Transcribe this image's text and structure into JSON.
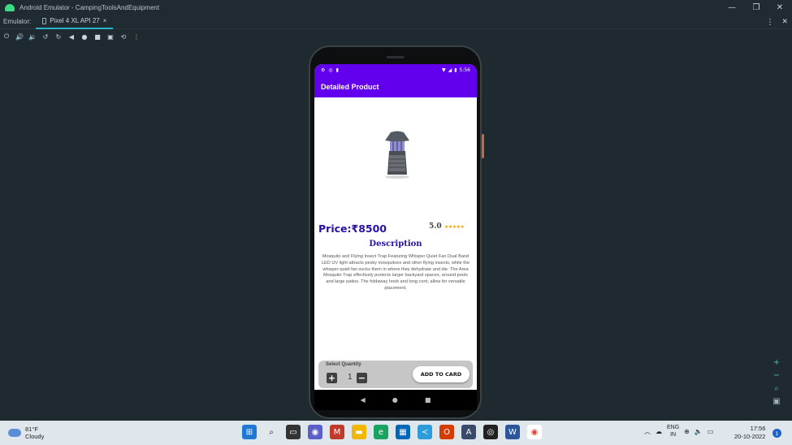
{
  "window": {
    "title": "Android Emulator - CampingToolsAndEquipment",
    "minimize": "—",
    "restore": "❐",
    "close": "✕"
  },
  "tabbar": {
    "label": "Emulator:",
    "tab_label": "Pixel 4 XL API 27",
    "tab_close": "×",
    "kebab": "⋮",
    "right_close": "✕"
  },
  "toolbar": {
    "icons": [
      "power-icon",
      "volume-up-icon",
      "volume-down-icon",
      "rotate-left-icon",
      "rotate-right-icon",
      "back-icon",
      "home-icon",
      "overview-icon",
      "camera-icon",
      "snapshot-icon",
      "more-icon"
    ]
  },
  "device": {
    "status_time": "5:56",
    "app_title": "Detailed Product",
    "price": "Price:₹8500",
    "rating": "5.0",
    "stars": "★★★★★",
    "description_title": "Description",
    "description": "Mosquito and Flying Insect Trap Featuring Whisper Quiet Fan Dual Band LED UV light attracts pesky mosquitoes and other flying insects, while the whisper-quiet fan sucks them in where they dehydrate and die. The Area Mosquito Trap effectively protects larger backyard spaces, around pools and large patios. The foldaway hook and long cord, allow for versatile placement.",
    "quantity_label": "Select Quantity",
    "quantity_value": "1",
    "plus": "+",
    "minus": "−",
    "add_button": "ADD TO CARD",
    "nav_back": "◀",
    "nav_home": "●",
    "nav_recent": "■"
  },
  "taskbar": {
    "temperature": "81°F",
    "condition": "Cloudy",
    "lang_line1": "ENG",
    "lang_line2": "IN",
    "time": "17:56",
    "date": "20-10-2022",
    "notification_count": "1"
  },
  "colors": {
    "accent": "#6200ee",
    "price": "#2a0fa8",
    "star": "#f5a100"
  }
}
